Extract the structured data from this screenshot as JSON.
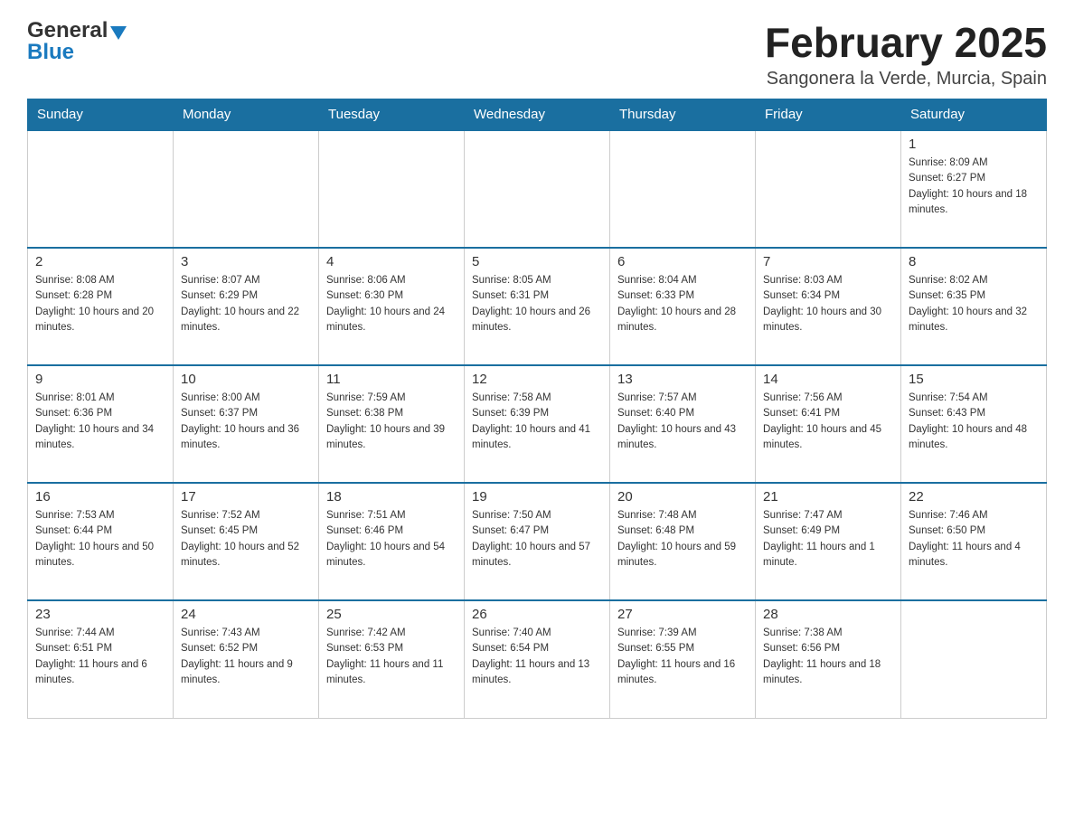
{
  "logo": {
    "general": "General",
    "blue": "Blue"
  },
  "title": "February 2025",
  "location": "Sangonera la Verde, Murcia, Spain",
  "days_of_week": [
    "Sunday",
    "Monday",
    "Tuesday",
    "Wednesday",
    "Thursday",
    "Friday",
    "Saturday"
  ],
  "weeks": [
    [
      {
        "day": "",
        "info": ""
      },
      {
        "day": "",
        "info": ""
      },
      {
        "day": "",
        "info": ""
      },
      {
        "day": "",
        "info": ""
      },
      {
        "day": "",
        "info": ""
      },
      {
        "day": "",
        "info": ""
      },
      {
        "day": "1",
        "info": "Sunrise: 8:09 AM\nSunset: 6:27 PM\nDaylight: 10 hours and 18 minutes."
      }
    ],
    [
      {
        "day": "2",
        "info": "Sunrise: 8:08 AM\nSunset: 6:28 PM\nDaylight: 10 hours and 20 minutes."
      },
      {
        "day": "3",
        "info": "Sunrise: 8:07 AM\nSunset: 6:29 PM\nDaylight: 10 hours and 22 minutes."
      },
      {
        "day": "4",
        "info": "Sunrise: 8:06 AM\nSunset: 6:30 PM\nDaylight: 10 hours and 24 minutes."
      },
      {
        "day": "5",
        "info": "Sunrise: 8:05 AM\nSunset: 6:31 PM\nDaylight: 10 hours and 26 minutes."
      },
      {
        "day": "6",
        "info": "Sunrise: 8:04 AM\nSunset: 6:33 PM\nDaylight: 10 hours and 28 minutes."
      },
      {
        "day": "7",
        "info": "Sunrise: 8:03 AM\nSunset: 6:34 PM\nDaylight: 10 hours and 30 minutes."
      },
      {
        "day": "8",
        "info": "Sunrise: 8:02 AM\nSunset: 6:35 PM\nDaylight: 10 hours and 32 minutes."
      }
    ],
    [
      {
        "day": "9",
        "info": "Sunrise: 8:01 AM\nSunset: 6:36 PM\nDaylight: 10 hours and 34 minutes."
      },
      {
        "day": "10",
        "info": "Sunrise: 8:00 AM\nSunset: 6:37 PM\nDaylight: 10 hours and 36 minutes."
      },
      {
        "day": "11",
        "info": "Sunrise: 7:59 AM\nSunset: 6:38 PM\nDaylight: 10 hours and 39 minutes."
      },
      {
        "day": "12",
        "info": "Sunrise: 7:58 AM\nSunset: 6:39 PM\nDaylight: 10 hours and 41 minutes."
      },
      {
        "day": "13",
        "info": "Sunrise: 7:57 AM\nSunset: 6:40 PM\nDaylight: 10 hours and 43 minutes."
      },
      {
        "day": "14",
        "info": "Sunrise: 7:56 AM\nSunset: 6:41 PM\nDaylight: 10 hours and 45 minutes."
      },
      {
        "day": "15",
        "info": "Sunrise: 7:54 AM\nSunset: 6:43 PM\nDaylight: 10 hours and 48 minutes."
      }
    ],
    [
      {
        "day": "16",
        "info": "Sunrise: 7:53 AM\nSunset: 6:44 PM\nDaylight: 10 hours and 50 minutes."
      },
      {
        "day": "17",
        "info": "Sunrise: 7:52 AM\nSunset: 6:45 PM\nDaylight: 10 hours and 52 minutes."
      },
      {
        "day": "18",
        "info": "Sunrise: 7:51 AM\nSunset: 6:46 PM\nDaylight: 10 hours and 54 minutes."
      },
      {
        "day": "19",
        "info": "Sunrise: 7:50 AM\nSunset: 6:47 PM\nDaylight: 10 hours and 57 minutes."
      },
      {
        "day": "20",
        "info": "Sunrise: 7:48 AM\nSunset: 6:48 PM\nDaylight: 10 hours and 59 minutes."
      },
      {
        "day": "21",
        "info": "Sunrise: 7:47 AM\nSunset: 6:49 PM\nDaylight: 11 hours and 1 minute."
      },
      {
        "day": "22",
        "info": "Sunrise: 7:46 AM\nSunset: 6:50 PM\nDaylight: 11 hours and 4 minutes."
      }
    ],
    [
      {
        "day": "23",
        "info": "Sunrise: 7:44 AM\nSunset: 6:51 PM\nDaylight: 11 hours and 6 minutes."
      },
      {
        "day": "24",
        "info": "Sunrise: 7:43 AM\nSunset: 6:52 PM\nDaylight: 11 hours and 9 minutes."
      },
      {
        "day": "25",
        "info": "Sunrise: 7:42 AM\nSunset: 6:53 PM\nDaylight: 11 hours and 11 minutes."
      },
      {
        "day": "26",
        "info": "Sunrise: 7:40 AM\nSunset: 6:54 PM\nDaylight: 11 hours and 13 minutes."
      },
      {
        "day": "27",
        "info": "Sunrise: 7:39 AM\nSunset: 6:55 PM\nDaylight: 11 hours and 16 minutes."
      },
      {
        "day": "28",
        "info": "Sunrise: 7:38 AM\nSunset: 6:56 PM\nDaylight: 11 hours and 18 minutes."
      },
      {
        "day": "",
        "info": ""
      }
    ]
  ]
}
